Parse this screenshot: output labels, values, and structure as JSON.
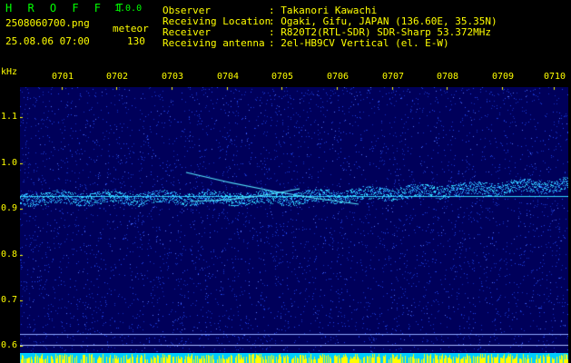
{
  "header": {
    "brand": "H R O F F T",
    "version": "1.0.0",
    "filename": "2508060700.png",
    "datetime": "25.08.06 07:00",
    "type_label": "meteor",
    "count": "130",
    "fields": [
      {
        "label": "Observer",
        "value": ": Takanori Kawachi"
      },
      {
        "label": "Receiving Location",
        "value": ": Ogaki, Gifu, JAPAN (136.60E, 35.35N)"
      },
      {
        "label": "Receiver",
        "value": ": R820T2(RTL-SDR) SDR-Sharp 53.372MHz"
      },
      {
        "label": "Receiving antenna",
        "value": ": 2el-HB9CV Vertical (el. E-W)"
      }
    ]
  },
  "axis": {
    "unit": "kHz",
    "time_labels": [
      "0701",
      "0702",
      "0703",
      "0704",
      "0705",
      "0706",
      "0707",
      "0708",
      "0709",
      "0710"
    ],
    "freq_labels": [
      "1.1",
      "1.0",
      "0.9",
      "0.8",
      "0.7",
      "0.6"
    ]
  },
  "colors": {
    "background": "#00005a",
    "noise": "#1a3cff",
    "signal": "#33ddff",
    "yellow": "#ffff00",
    "green": "#00ff00"
  }
}
